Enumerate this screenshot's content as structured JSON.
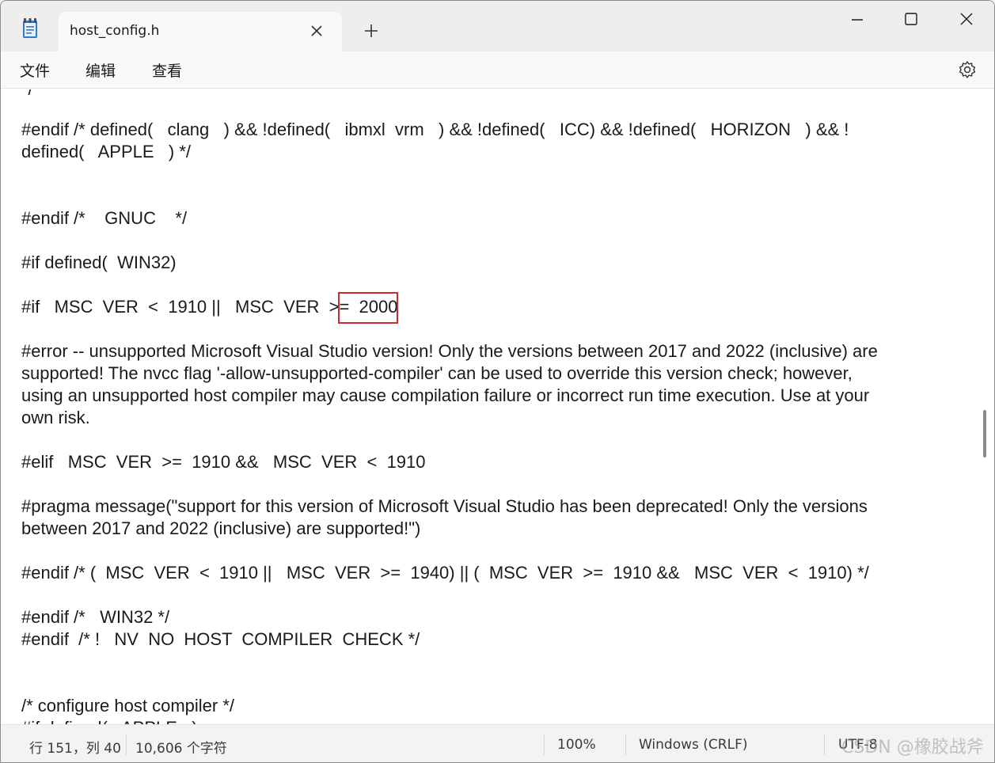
{
  "tab": {
    "title": "host_config.h"
  },
  "menu": {
    "file": "文件",
    "edit": "编辑",
    "view": "查看"
  },
  "editor": {
    "lines": [
      "*/",
      "#endif /* defined(   clang   ) && !defined(   ibmxl  vrm   ) && !defined(   ICC) && !defined(   HORIZON   ) && !",
      "defined(   APPLE   ) */",
      "#endif /*    GNUC    */",
      "#if defined(  WIN32)",
      "#if   MSC  VER  <  1910 ||   MSC  VER  >=  2000",
      "#error -- unsupported Microsoft Visual Studio version! Only the versions between 2017 and 2022 (inclusive) are",
      "supported! The nvcc flag '-allow-unsupported-compiler' can be used to override this version check; however,",
      "using an unsupported host compiler may cause compilation failure or incorrect run time execution. Use at your",
      "own risk.",
      "#elif   MSC  VER  >=  1910 &&   MSC  VER  <  1910",
      "#pragma message(\"support for this version of Microsoft Visual Studio has been deprecated! Only the versions",
      "between 2017 and 2022 (inclusive) are supported!\")",
      "#endif /* (  MSC  VER  <  1910 ||   MSC  VER  >=  1940) || (  MSC  VER  >=  1910 &&   MSC  VER  <  1910) */",
      "#endif /*   WIN32 */",
      "#endif  /* !   NV  NO  HOST  COMPILER  CHECK */",
      "/* configure host compiler */",
      "#if defined(   APPLE   )"
    ]
  },
  "status": {
    "position": "行 151，列 40",
    "chars": "10,606 个字符",
    "zoom": "100%",
    "line_ending": "Windows (CRLF)",
    "encoding": "UTF-8"
  },
  "watermark": "CSDN @橡胶战斧",
  "colors": {
    "highlight_box": "#d6262b",
    "text": "#1a1a1a"
  }
}
